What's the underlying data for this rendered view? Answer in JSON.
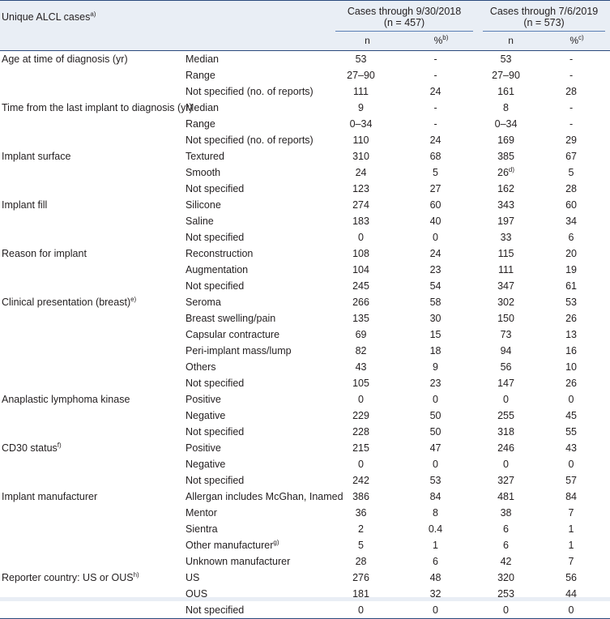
{
  "header": {
    "row_label": "Unique ALCL cases",
    "row_label_sup": "a)",
    "groups": [
      {
        "title": "Cases through 9/30/2018",
        "subtitle": "(n = 457)",
        "col_n": "n",
        "col_pct": "%",
        "col_pct_sup": "b)"
      },
      {
        "title": "Cases through 7/6/2019",
        "subtitle": "(n = 573)",
        "col_n": "n",
        "col_pct": "%",
        "col_pct_sup": "c)"
      }
    ]
  },
  "colors": {
    "header_bg": "#e9eef5",
    "rule": "#2b4a7d",
    "thin_rule": "#5a7fb5",
    "text": "#231f20"
  },
  "rows": [
    {
      "category": "Age at time of diagnosis (yr)",
      "category_sup": "",
      "sub": "Median",
      "sub_sup": "",
      "n1": "53",
      "p1": "-",
      "n2": "53",
      "n2_sup": "",
      "p2": "-"
    },
    {
      "category": "",
      "category_sup": "",
      "sub": "Range",
      "sub_sup": "",
      "n1": "27–90",
      "p1": "-",
      "n2": "27–90",
      "n2_sup": "",
      "p2": "-"
    },
    {
      "category": "",
      "category_sup": "",
      "sub": "Not specified (no. of reports)",
      "sub_sup": "",
      "n1": "111",
      "p1": "24",
      "n2": "161",
      "n2_sup": "",
      "p2": "28"
    },
    {
      "category": "Time from the last implant to diagnosis (yr)",
      "category_sup": "",
      "sub": "Median",
      "sub_sup": "",
      "n1": "9",
      "p1": "-",
      "n2": "8",
      "n2_sup": "",
      "p2": "-"
    },
    {
      "category": "",
      "category_sup": "",
      "sub": "Range",
      "sub_sup": "",
      "n1": "0–34",
      "p1": "-",
      "n2": "0–34",
      "n2_sup": "",
      "p2": "-"
    },
    {
      "category": "",
      "category_sup": "",
      "sub": "Not specified (no. of reports)",
      "sub_sup": "",
      "n1": "110",
      "p1": "24",
      "n2": "169",
      "n2_sup": "",
      "p2": "29"
    },
    {
      "category": "Implant surface",
      "category_sup": "",
      "sub": "Textured",
      "sub_sup": "",
      "n1": "310",
      "p1": "68",
      "n2": "385",
      "n2_sup": "",
      "p2": "67"
    },
    {
      "category": "",
      "category_sup": "",
      "sub": "Smooth",
      "sub_sup": "",
      "n1": "24",
      "p1": "5",
      "n2": "26",
      "n2_sup": "d)",
      "p2": "5"
    },
    {
      "category": "",
      "category_sup": "",
      "sub": "Not specified",
      "sub_sup": "",
      "n1": "123",
      "p1": "27",
      "n2": "162",
      "n2_sup": "",
      "p2": "28"
    },
    {
      "category": "Implant fill",
      "category_sup": "",
      "sub": "Silicone",
      "sub_sup": "",
      "n1": "274",
      "p1": "60",
      "n2": "343",
      "n2_sup": "",
      "p2": "60"
    },
    {
      "category": "",
      "category_sup": "",
      "sub": "Saline",
      "sub_sup": "",
      "n1": "183",
      "p1": "40",
      "n2": "197",
      "n2_sup": "",
      "p2": "34"
    },
    {
      "category": "",
      "category_sup": "",
      "sub": "Not specified",
      "sub_sup": "",
      "n1": "0",
      "p1": "0",
      "n2": "33",
      "n2_sup": "",
      "p2": "6"
    },
    {
      "category": "Reason for implant",
      "category_sup": "",
      "sub": "Reconstruction",
      "sub_sup": "",
      "n1": "108",
      "p1": "24",
      "n2": "115",
      "n2_sup": "",
      "p2": "20"
    },
    {
      "category": "",
      "category_sup": "",
      "sub": "Augmentation",
      "sub_sup": "",
      "n1": "104",
      "p1": "23",
      "n2": "111",
      "n2_sup": "",
      "p2": "19"
    },
    {
      "category": "",
      "category_sup": "",
      "sub": "Not specified",
      "sub_sup": "",
      "n1": "245",
      "p1": "54",
      "n2": "347",
      "n2_sup": "",
      "p2": "61"
    },
    {
      "category": "Clinical presentation (breast)",
      "category_sup": "e)",
      "sub": "Seroma",
      "sub_sup": "",
      "n1": "266",
      "p1": "58",
      "n2": "302",
      "n2_sup": "",
      "p2": "53"
    },
    {
      "category": "",
      "category_sup": "",
      "sub": "Breast swelling/pain",
      "sub_sup": "",
      "n1": "135",
      "p1": "30",
      "n2": "150",
      "n2_sup": "",
      "p2": "26"
    },
    {
      "category": "",
      "category_sup": "",
      "sub": "Capsular contracture",
      "sub_sup": "",
      "n1": "69",
      "p1": "15",
      "n2": "73",
      "n2_sup": "",
      "p2": "13"
    },
    {
      "category": "",
      "category_sup": "",
      "sub": "Peri-implant mass/lump",
      "sub_sup": "",
      "n1": "82",
      "p1": "18",
      "n2": "94",
      "n2_sup": "",
      "p2": "16"
    },
    {
      "category": "",
      "category_sup": "",
      "sub": "Others",
      "sub_sup": "",
      "n1": "43",
      "p1": "9",
      "n2": "56",
      "n2_sup": "",
      "p2": "10"
    },
    {
      "category": "",
      "category_sup": "",
      "sub": "Not specified",
      "sub_sup": "",
      "n1": "105",
      "p1": "23",
      "n2": "147",
      "n2_sup": "",
      "p2": "26"
    },
    {
      "category": "Anaplastic lymphoma kinase",
      "category_sup": "",
      "sub": "Positive",
      "sub_sup": "",
      "n1": "0",
      "p1": "0",
      "n2": "0",
      "n2_sup": "",
      "p2": "0"
    },
    {
      "category": "",
      "category_sup": "",
      "sub": "Negative",
      "sub_sup": "",
      "n1": "229",
      "p1": "50",
      "n2": "255",
      "n2_sup": "",
      "p2": "45"
    },
    {
      "category": "",
      "category_sup": "",
      "sub": "Not specified",
      "sub_sup": "",
      "n1": "228",
      "p1": "50",
      "n2": "318",
      "n2_sup": "",
      "p2": "55"
    },
    {
      "category": "CD30 status",
      "category_sup": "f)",
      "sub": "Positive",
      "sub_sup": "",
      "n1": "215",
      "p1": "47",
      "n2": "246",
      "n2_sup": "",
      "p2": "43"
    },
    {
      "category": "",
      "category_sup": "",
      "sub": "Negative",
      "sub_sup": "",
      "n1": "0",
      "p1": "0",
      "n2": "0",
      "n2_sup": "",
      "p2": "0"
    },
    {
      "category": "",
      "category_sup": "",
      "sub": "Not specified",
      "sub_sup": "",
      "n1": "242",
      "p1": "53",
      "n2": "327",
      "n2_sup": "",
      "p2": "57"
    },
    {
      "category": "Implant manufacturer",
      "category_sup": "",
      "sub": "Allergan includes McGhan, Inamed",
      "sub_sup": "",
      "n1": "386",
      "p1": "84",
      "n2": "481",
      "n2_sup": "",
      "p2": "84"
    },
    {
      "category": "",
      "category_sup": "",
      "sub": "Mentor",
      "sub_sup": "",
      "n1": "36",
      "p1": "8",
      "n2": "38",
      "n2_sup": "",
      "p2": "7"
    },
    {
      "category": "",
      "category_sup": "",
      "sub": "Sientra",
      "sub_sup": "",
      "n1": "2",
      "p1": "0.4",
      "n2": "6",
      "n2_sup": "",
      "p2": "1"
    },
    {
      "category": "",
      "category_sup": "",
      "sub": "Other manufacturer",
      "sub_sup": "g)",
      "n1": "5",
      "p1": "1",
      "n2": "6",
      "n2_sup": "",
      "p2": "1"
    },
    {
      "category": "",
      "category_sup": "",
      "sub": "Unknown manufacturer",
      "sub_sup": "",
      "n1": "28",
      "p1": "6",
      "n2": "42",
      "n2_sup": "",
      "p2": "7"
    },
    {
      "category": "Reporter country: US or OUS",
      "category_sup": "h)",
      "sub": "US",
      "sub_sup": "",
      "n1": "276",
      "p1": "48",
      "n2": "320",
      "n2_sup": "",
      "p2": "56"
    },
    {
      "category": "",
      "category_sup": "",
      "sub": "OUS",
      "sub_sup": "",
      "n1": "181",
      "p1": "32",
      "n2": "253",
      "n2_sup": "",
      "p2": "44"
    },
    {
      "category": "",
      "category_sup": "",
      "sub": "Not specified",
      "sub_sup": "",
      "n1": "0",
      "p1": "0",
      "n2": "0",
      "n2_sup": "",
      "p2": "0"
    }
  ]
}
